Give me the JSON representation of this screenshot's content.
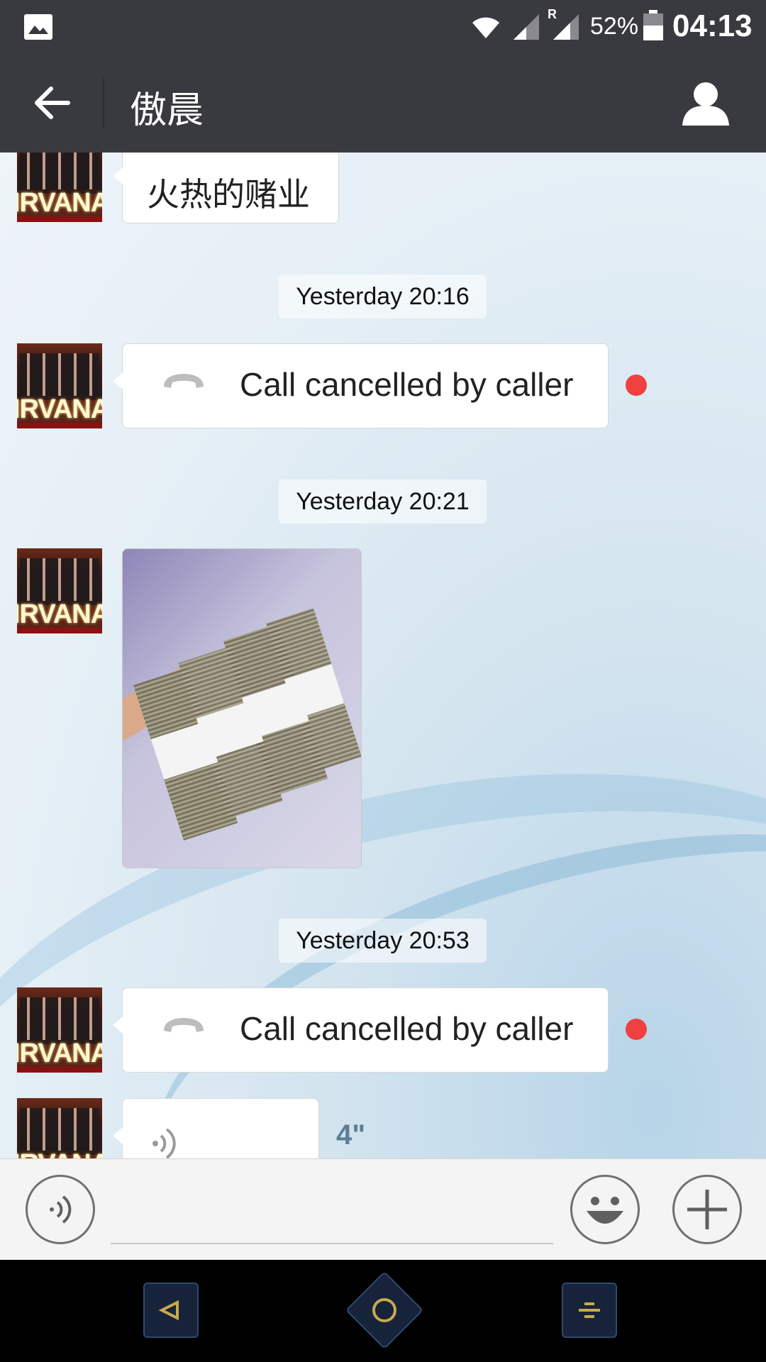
{
  "status_bar": {
    "battery": "52%",
    "time": "04:13",
    "icons": [
      "gallery-icon",
      "wifi-icon",
      "signal-icon",
      "roaming-signal-icon",
      "battery-icon"
    ],
    "roaming_label": "R"
  },
  "header": {
    "title": "傲晨",
    "back_icon": "arrow-left-icon",
    "profile_icon": "person-icon"
  },
  "avatar_text": "IRVANA",
  "messages": [
    {
      "type": "text",
      "text": "火热的赌业"
    },
    {
      "type": "timestamp",
      "text": "Yesterday 20:16"
    },
    {
      "type": "call",
      "text": "Call cancelled by caller",
      "unread": true
    },
    {
      "type": "timestamp",
      "text": "Yesterday 20:21"
    },
    {
      "type": "image",
      "description_icon": "photo-icon"
    },
    {
      "type": "timestamp",
      "text": "Yesterday 20:53"
    },
    {
      "type": "call",
      "text": "Call cancelled by caller",
      "unread": true
    },
    {
      "type": "voice",
      "duration": "4\""
    }
  ],
  "input_bar": {
    "voice_icon": "voice-mode-icon",
    "emoji_icon": "emoji-icon",
    "plus_icon": "plus-icon",
    "text_value": ""
  },
  "colors": {
    "bar": "#393a3f",
    "unread_dot": "#f04040",
    "voice_duration": "#5d7d98"
  }
}
